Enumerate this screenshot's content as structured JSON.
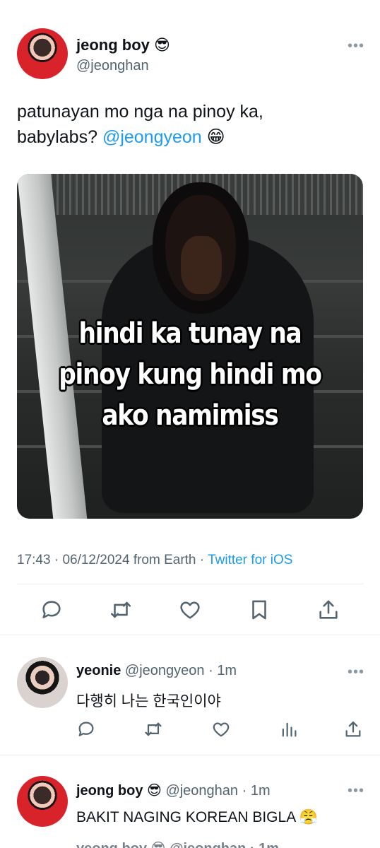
{
  "main_tweet": {
    "author_name": "jeong boy",
    "author_emoji": "😎",
    "handle": "@jeonghan",
    "text_line1": "patunayan mo nga na pinoy ka,",
    "text_line2_prefix": "babylabs? ",
    "mention": "@jeongyeon",
    "text_emoji": "😁",
    "meme_text_line1": "hindi ka tunay na",
    "meme_text_line2": "pinoy kung hindi mo",
    "meme_text_line3": "ako namimiss",
    "time": "17:43",
    "date": "06/12/2024",
    "location": "from Earth",
    "separator": " · ",
    "source": "Twitter for iOS",
    "more": "•••"
  },
  "replies": [
    {
      "name": "yeonie",
      "handle": "@jeongyeon",
      "time": "1m",
      "text": "다행히 나는 한국인이야",
      "more": "•••"
    },
    {
      "name": "jeong boy",
      "name_emoji": "😎",
      "handle": "@jeonghan",
      "time": "1m",
      "text": "BAKIT NAGING KOREAN BIGLA",
      "text_emoji": "😤",
      "more": "•••"
    }
  ],
  "cut_off_line": "yeong boy 😎 @jeonghan · 1m",
  "icons": [
    "reply-icon",
    "retweet-icon",
    "like-icon",
    "bookmark-icon",
    "share-icon",
    "views-icon"
  ],
  "colors": {
    "accent": "#1d9bf0",
    "secondary_text": "#536471",
    "primary_text": "#0f1419",
    "icon": "#536471"
  }
}
